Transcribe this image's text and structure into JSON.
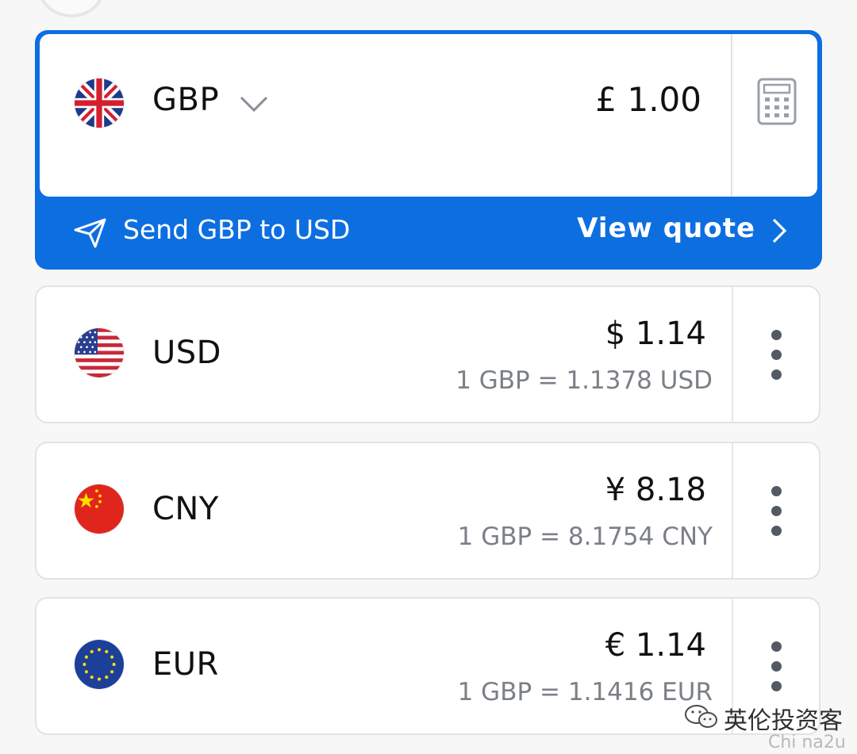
{
  "base": {
    "flag": "uk-flag-icon",
    "currency": "GBP",
    "amount": "£ 1.00",
    "dropdown_icon": "chevron-down-icon",
    "calculator_icon": "calculator-icon"
  },
  "send": {
    "icon": "send-icon",
    "label": "Send GBP to USD",
    "quote_label": "View quote",
    "quote_icon": "chevron-right-icon"
  },
  "currencies": [
    {
      "code": "USD",
      "flag": "us-flag-icon",
      "value": "$ 1.14",
      "rate": "1 GBP = 1.1378 USD"
    },
    {
      "code": "CNY",
      "flag": "cn-flag-icon",
      "value": "¥ 8.18",
      "rate": "1 GBP = 8.1754 CNY"
    },
    {
      "code": "EUR",
      "flag": "eu-flag-icon",
      "value": "€ 1.14",
      "rate": "1 GBP = 1.1416 EUR"
    }
  ],
  "watermark": {
    "text": "英伦投资客",
    "sub": "Chi na2u"
  },
  "colors": {
    "accent": "#0d6ee0",
    "text": "#111111",
    "muted": "#7b7f86"
  }
}
